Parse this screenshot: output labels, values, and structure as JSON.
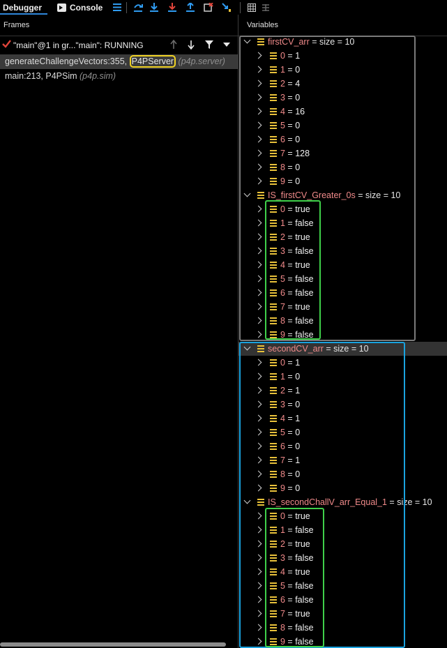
{
  "toolbar": {
    "tabs": [
      {
        "label": "Debugger"
      },
      {
        "label": "Console"
      }
    ],
    "icons": [
      "frames-list-icon",
      "step-over-icon",
      "step-into-icon",
      "force-step-into-icon",
      "step-out-icon",
      "drop-frame-icon",
      "run-to-cursor-icon",
      "evaluate-expression-icon",
      "table-view-icon"
    ]
  },
  "frames": {
    "header": "Frames",
    "thread_label": "\"main\"@1 in gr...\"main\": RUNNING",
    "items": [
      {
        "method": "generateChallengeVectors:355, ",
        "class_name": "P4PServer",
        "location": " (p4p.server)"
      },
      {
        "method": "main:213, P4PSim",
        "class_name": "",
        "location": " (p4p.sim)"
      }
    ]
  },
  "variables": {
    "header": "Variables",
    "groups": [
      {
        "name": "firstCV_arr",
        "summary": " =  size = 10",
        "items": [
          {
            "index": "0",
            "value": "1"
          },
          {
            "index": "1",
            "value": "0"
          },
          {
            "index": "2",
            "value": "4"
          },
          {
            "index": "3",
            "value": "0"
          },
          {
            "index": "4",
            "value": "16"
          },
          {
            "index": "5",
            "value": "0"
          },
          {
            "index": "6",
            "value": "0"
          },
          {
            "index": "7",
            "value": "128"
          },
          {
            "index": "8",
            "value": "0"
          },
          {
            "index": "9",
            "value": "0"
          }
        ]
      },
      {
        "name": "IS_firstCV_Greater_0s",
        "summary": " =  size = 10",
        "items": [
          {
            "index": "0",
            "value": "true"
          },
          {
            "index": "1",
            "value": "false"
          },
          {
            "index": "2",
            "value": "true"
          },
          {
            "index": "3",
            "value": "false"
          },
          {
            "index": "4",
            "value": "true"
          },
          {
            "index": "5",
            "value": "false"
          },
          {
            "index": "6",
            "value": "false"
          },
          {
            "index": "7",
            "value": "true"
          },
          {
            "index": "8",
            "value": "false"
          },
          {
            "index": "9",
            "value": "false"
          }
        ]
      },
      {
        "name": "secondCV_arr",
        "summary": " =  size = 10",
        "items": [
          {
            "index": "0",
            "value": "1"
          },
          {
            "index": "1",
            "value": "0"
          },
          {
            "index": "2",
            "value": "1"
          },
          {
            "index": "3",
            "value": "0"
          },
          {
            "index": "4",
            "value": "1"
          },
          {
            "index": "5",
            "value": "0"
          },
          {
            "index": "6",
            "value": "0"
          },
          {
            "index": "7",
            "value": "1"
          },
          {
            "index": "8",
            "value": "0"
          },
          {
            "index": "9",
            "value": "0"
          }
        ]
      },
      {
        "name": "IS_secondChallV_arr_Equal_1",
        "summary": " =  size = 10",
        "items": [
          {
            "index": "0",
            "value": "true"
          },
          {
            "index": "1",
            "value": "false"
          },
          {
            "index": "2",
            "value": "true"
          },
          {
            "index": "3",
            "value": "false"
          },
          {
            "index": "4",
            "value": "true"
          },
          {
            "index": "5",
            "value": "false"
          },
          {
            "index": "6",
            "value": "false"
          },
          {
            "index": "7",
            "value": "true"
          },
          {
            "index": "8",
            "value": "false"
          },
          {
            "index": "9",
            "value": "false"
          }
        ]
      }
    ]
  },
  "colors": {
    "background": "#000000",
    "variable_name": "#f08a8a",
    "field_icon": "#e8c13a",
    "highlight_yellow": "#f0d224",
    "highlight_green": "#3fd04a",
    "highlight_blue": "#1aa3df",
    "highlight_gray": "#7a7a7a",
    "tab_underline": "#2f86d9"
  }
}
